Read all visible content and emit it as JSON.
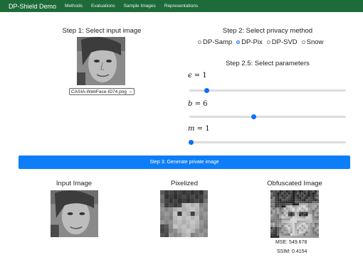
{
  "navbar": {
    "brand": "DP-Shield Demo",
    "links": [
      "Methods",
      "Evaluations",
      "Sample Images",
      "Representations"
    ],
    "color": "#1e6b3a"
  },
  "step1": {
    "title": "Step 1: Select input image",
    "selected_file": "CASIA-WebFace-ID74.png"
  },
  "step2": {
    "title": "Step 2: Select privacy method",
    "methods": [
      "DP-Samp",
      "DP-Pix",
      "DP-SVD",
      "Snow"
    ],
    "selected": "DP-Pix"
  },
  "step25": {
    "title": "Step 2.5: Select parameters",
    "params": [
      {
        "symbol": "ϵ",
        "value": "1",
        "slider_fraction": 0.1
      },
      {
        "symbol": "b",
        "value": "6",
        "slider_fraction": 0.4
      },
      {
        "symbol": "m",
        "value": "1",
        "slider_fraction": 0.0
      }
    ]
  },
  "step3": {
    "button_label": "Step 3: Generate private image",
    "color": "#0d7ef8"
  },
  "results": {
    "input_title": "Input Image",
    "pixelized_title": "Pixelized",
    "obfuscated_title": "Obfuscated Image",
    "mse": "MSE: 549.678",
    "ssim": "SSIM: 0.4154"
  }
}
